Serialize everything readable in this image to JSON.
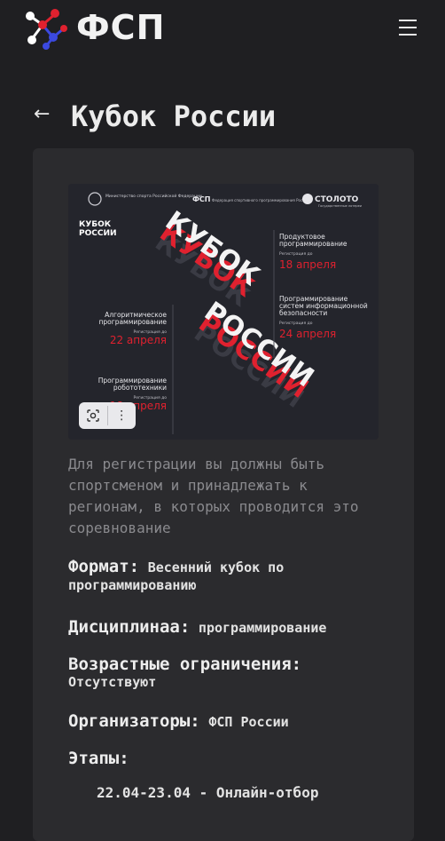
{
  "header": {
    "logo_text": "ФСП",
    "logo_icon": "molecule-icon",
    "menu_icon": "hamburger-icon"
  },
  "page": {
    "back_icon": "arrow-left-icon",
    "back_glyph": "←",
    "title": "Кубок России"
  },
  "poster": {
    "ministry": "Министерство спорта Российской Федерации",
    "fsp": "ФСП",
    "fsp_sub": "Федерация спортивного программирования России",
    "stoloto": "СТОЛОТО",
    "stoloto_sub": "Государственные лотереи",
    "badge_line1": "КУБОК",
    "badge_line2": "РОССИИ",
    "big_word1": "КУБОК",
    "big_word2": "РОССИИ",
    "reg_label": "Регистрация до",
    "left_items": [
      {
        "title_lines": [
          "Алгоритмическое",
          "программирование"
        ],
        "date": "22 апреля"
      },
      {
        "title_lines": [
          "Программирование",
          "робототехники"
        ],
        "date": "18 апреля"
      }
    ],
    "right_items": [
      {
        "title_lines": [
          "Продуктовое",
          "программирование"
        ],
        "date": "18 апреля"
      },
      {
        "title_lines": [
          "Программирование",
          "систем информационной",
          "безопасности"
        ],
        "date": "24 апреля"
      }
    ],
    "tools": {
      "lens_icon": "lens-icon",
      "more_icon": "more-vertical-icon",
      "more_glyph": "⋮"
    }
  },
  "description": "Для регистрации вы должны быть спортсменом и принадлежать к регионам, в которых проводится это соревнование",
  "details": {
    "format_label": "Формат:",
    "format_value": "Весенний кубок по программированию",
    "discipline_label": "Дисциплинаа:",
    "discipline_value": "программирование",
    "age_label": "Возрастные ограничения:",
    "age_value": "Отсутствуют",
    "organizers_label": "Организаторы:",
    "organizers_value": "ФСП России",
    "stages_label": "Этапы:",
    "stages": [
      "22.04-23.04 - Онлайн-отбор"
    ]
  },
  "colors": {
    "background": "#1f1f22",
    "card": "#2b2b2e",
    "accent_red": "#e0212f",
    "logo_blue": "#3b49e0"
  }
}
